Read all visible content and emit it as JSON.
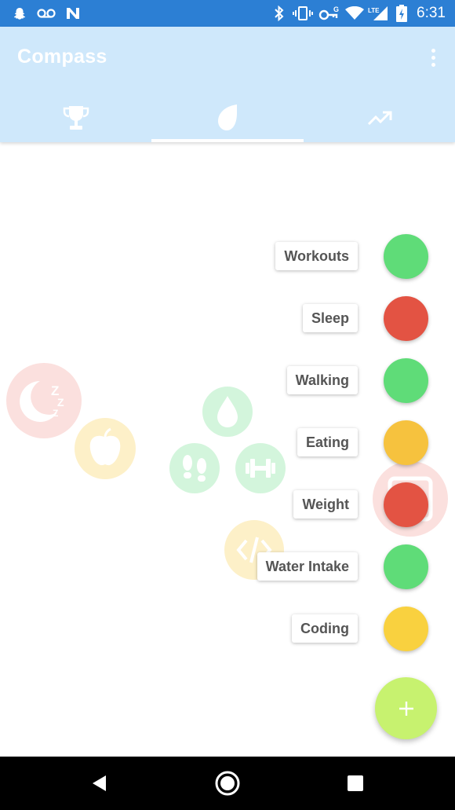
{
  "status_bar": {
    "time": "6:31",
    "icons": [
      "snapchat-icon",
      "voicemail-icon",
      "n-notification-icon",
      "bluetooth-icon",
      "vibrate-icon",
      "vpn-key-icon",
      "wifi-icon",
      "lte-signal-icon",
      "battery-charging-icon"
    ]
  },
  "app_bar": {
    "title": "Compass",
    "menu_icon": "more-vert-icon"
  },
  "tabs": [
    {
      "icon": "trophy-icon",
      "selected": false
    },
    {
      "icon": "leaf-icon",
      "selected": true
    },
    {
      "icon": "trending-up-icon",
      "selected": false
    }
  ],
  "fab_menu": {
    "items": [
      {
        "label": "Workouts",
        "color": "#5fdc78"
      },
      {
        "label": "Sleep",
        "color": "#e35343"
      },
      {
        "label": "Walking",
        "color": "#5fdc78"
      },
      {
        "label": "Eating",
        "color": "#f6c23e"
      },
      {
        "label": "Weight",
        "color": "#e35343"
      },
      {
        "label": "Water Intake",
        "color": "#5fdc78"
      },
      {
        "label": "Coding",
        "color": "#f9d13f"
      }
    ],
    "main_icon": "plus-icon",
    "main_color": "#c7f26f"
  },
  "background_icons": [
    "sleep-zzz-icon",
    "apple-icon",
    "water-drop-icon",
    "footsteps-icon",
    "dumbbell-icon",
    "code-icon",
    "scale-icon"
  ],
  "nav_bar": {
    "buttons": [
      "back-icon",
      "home-icon",
      "recents-icon"
    ]
  }
}
